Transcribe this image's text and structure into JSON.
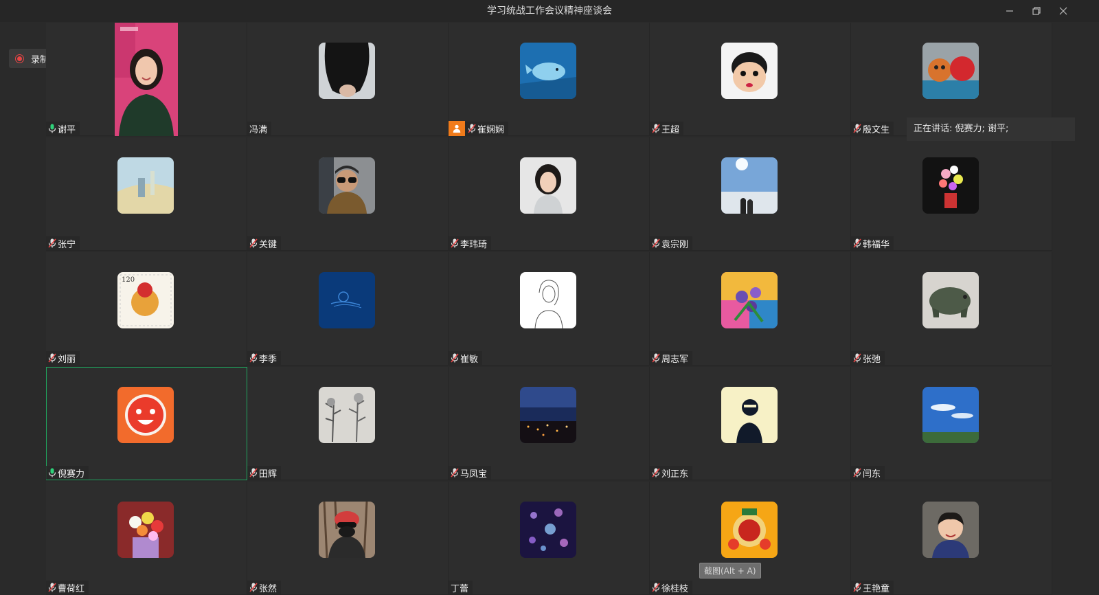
{
  "window": {
    "title": "学习统战工作会议精神座谈会"
  },
  "recording": {
    "label": "录制中",
    "color": "#e84545"
  },
  "speaking": {
    "text": "正在讲话: 倪赛力; 谢平;"
  },
  "screenshot_hint": "截图(Alt + A)",
  "active_color": "#1fa85f",
  "raise_hand_color": "#f07b1b",
  "participants": [
    {
      "name": "谢平",
      "mic": "on",
      "avatar": "video"
    },
    {
      "name": "冯满",
      "mic": "none",
      "avatar": "hair"
    },
    {
      "name": "崔娴娴",
      "mic": "muted",
      "hand": true,
      "avatar": "whale"
    },
    {
      "name": "王超",
      "mic": "muted",
      "avatar": "cartoon"
    },
    {
      "name": "殷文生",
      "mic": "muted",
      "avatar": "toys"
    },
    {
      "name": "张宁",
      "mic": "muted",
      "avatar": "painting"
    },
    {
      "name": "关键",
      "mic": "muted",
      "avatar": "man-glasses"
    },
    {
      "name": "李玮琦",
      "mic": "muted",
      "avatar": "woman"
    },
    {
      "name": "袁宗刚",
      "mic": "muted",
      "avatar": "clouds"
    },
    {
      "name": "韩福华",
      "mic": "muted",
      "avatar": "flowers-dark"
    },
    {
      "name": "刘丽",
      "mic": "muted",
      "avatar": "stamp"
    },
    {
      "name": "李季",
      "mic": "muted",
      "avatar": "blue-logo"
    },
    {
      "name": "崔敏",
      "mic": "muted",
      "avatar": "sketch"
    },
    {
      "name": "周志军",
      "mic": "muted",
      "avatar": "flowers-color"
    },
    {
      "name": "张弛",
      "mic": "muted",
      "avatar": "stone-pig"
    },
    {
      "name": "倪赛力",
      "mic": "on",
      "active": true,
      "avatar": "red-face"
    },
    {
      "name": "田辉",
      "mic": "muted",
      "avatar": "ink-painting"
    },
    {
      "name": "马凤宝",
      "mic": "muted",
      "avatar": "night-city"
    },
    {
      "name": "刘正东",
      "mic": "muted",
      "avatar": "silhouette"
    },
    {
      "name": "闫东",
      "mic": "muted",
      "avatar": "sky"
    },
    {
      "name": "曹荷红",
      "mic": "muted",
      "avatar": "bouquet"
    },
    {
      "name": "张然",
      "mic": "muted",
      "avatar": "cyclist"
    },
    {
      "name": "丁蕾",
      "mic": "none",
      "avatar": "jellyfish"
    },
    {
      "name": "徐桂枝",
      "mic": "muted",
      "avatar": "ornament"
    },
    {
      "name": "王艳童",
      "mic": "muted",
      "avatar": "child"
    }
  ]
}
